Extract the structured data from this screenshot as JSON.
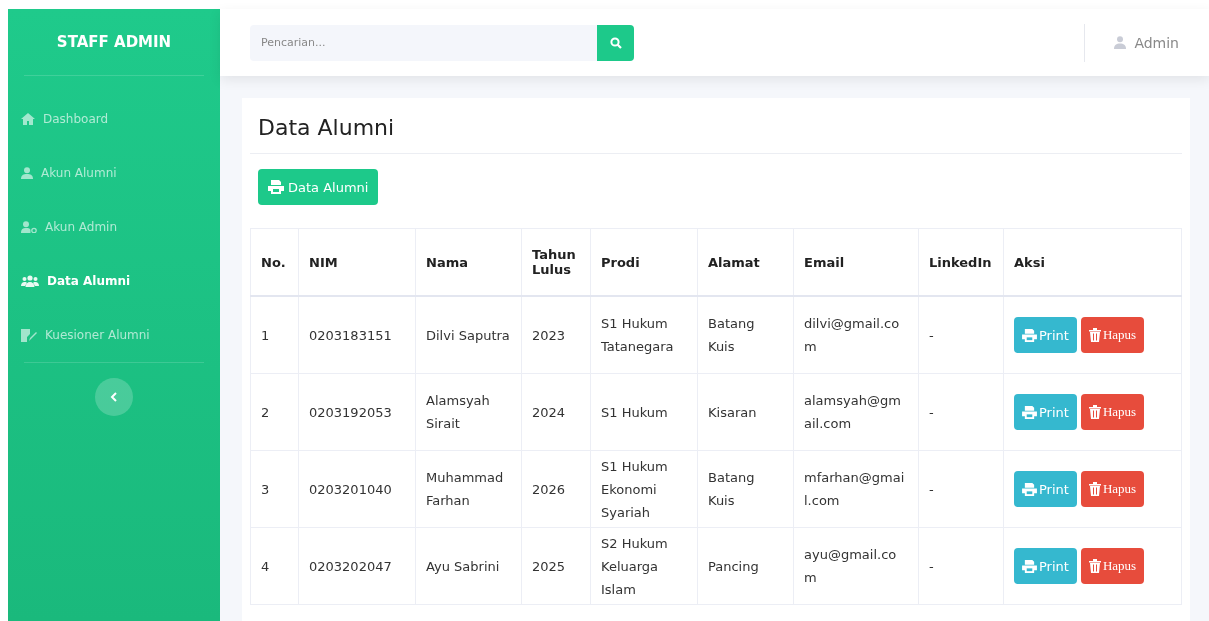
{
  "sidebar": {
    "brand": "STAFF ADMIN",
    "items": [
      {
        "label": "Dashboard",
        "selected": false
      },
      {
        "label": "Akun Alumni",
        "selected": false
      },
      {
        "label": "Akun Admin",
        "selected": false
      },
      {
        "label": "Data Alumni",
        "selected": true
      },
      {
        "label": "Kuesioner Alumni",
        "selected": false
      }
    ]
  },
  "topbar": {
    "search": {
      "placeholder": "Pencarian..."
    },
    "user": "Admin"
  },
  "page": {
    "title": "Data Alumni",
    "export_button": "Data Alumni"
  },
  "table": {
    "columns": [
      "No.",
      "NIM",
      "Nama",
      "Tahun Lulus",
      "Prodi",
      "Alamat",
      "Email",
      "LinkedIn",
      "Aksi"
    ],
    "rows": [
      {
        "cells": [
          "1",
          "0203183151",
          "Dilvi Saputra",
          "2023",
          "S1 Hukum Tatanegara",
          "Batang Kuis",
          "dilvi@gmail.com",
          "-"
        ],
        "actions": [
          {
            "label": "Print",
            "kind": "print"
          },
          {
            "label": "Hapus",
            "kind": "delete"
          }
        ]
      },
      {
        "cells": [
          "2",
          "0203192053",
          "Alamsyah Sirait",
          "2024",
          "S1 Hukum",
          "Kisaran",
          "alamsyah@gmail.com",
          "-"
        ],
        "actions": [
          {
            "label": "Print",
            "kind": "print"
          },
          {
            "label": "Hapus",
            "kind": "delete"
          }
        ]
      },
      {
        "cells": [
          "3",
          "0203201040",
          "Muhammad Farhan",
          "2026",
          "S1 Hukum Ekonomi Syariah",
          "Batang Kuis",
          "mfarhan@gmail.com",
          "-"
        ],
        "actions": [
          {
            "label": "Print",
            "kind": "print"
          },
          {
            "label": "Hapus",
            "kind": "delete"
          }
        ]
      },
      {
        "cells": [
          "4",
          "0203202047",
          "Ayu Sabrini",
          "2025",
          "S2 Hukum Keluarga Islam",
          "Pancing",
          "ayu@gmail.com",
          "-"
        ],
        "actions": [
          {
            "label": "Print",
            "kind": "print"
          },
          {
            "label": "Hapus",
            "kind": "delete"
          }
        ]
      }
    ]
  }
}
